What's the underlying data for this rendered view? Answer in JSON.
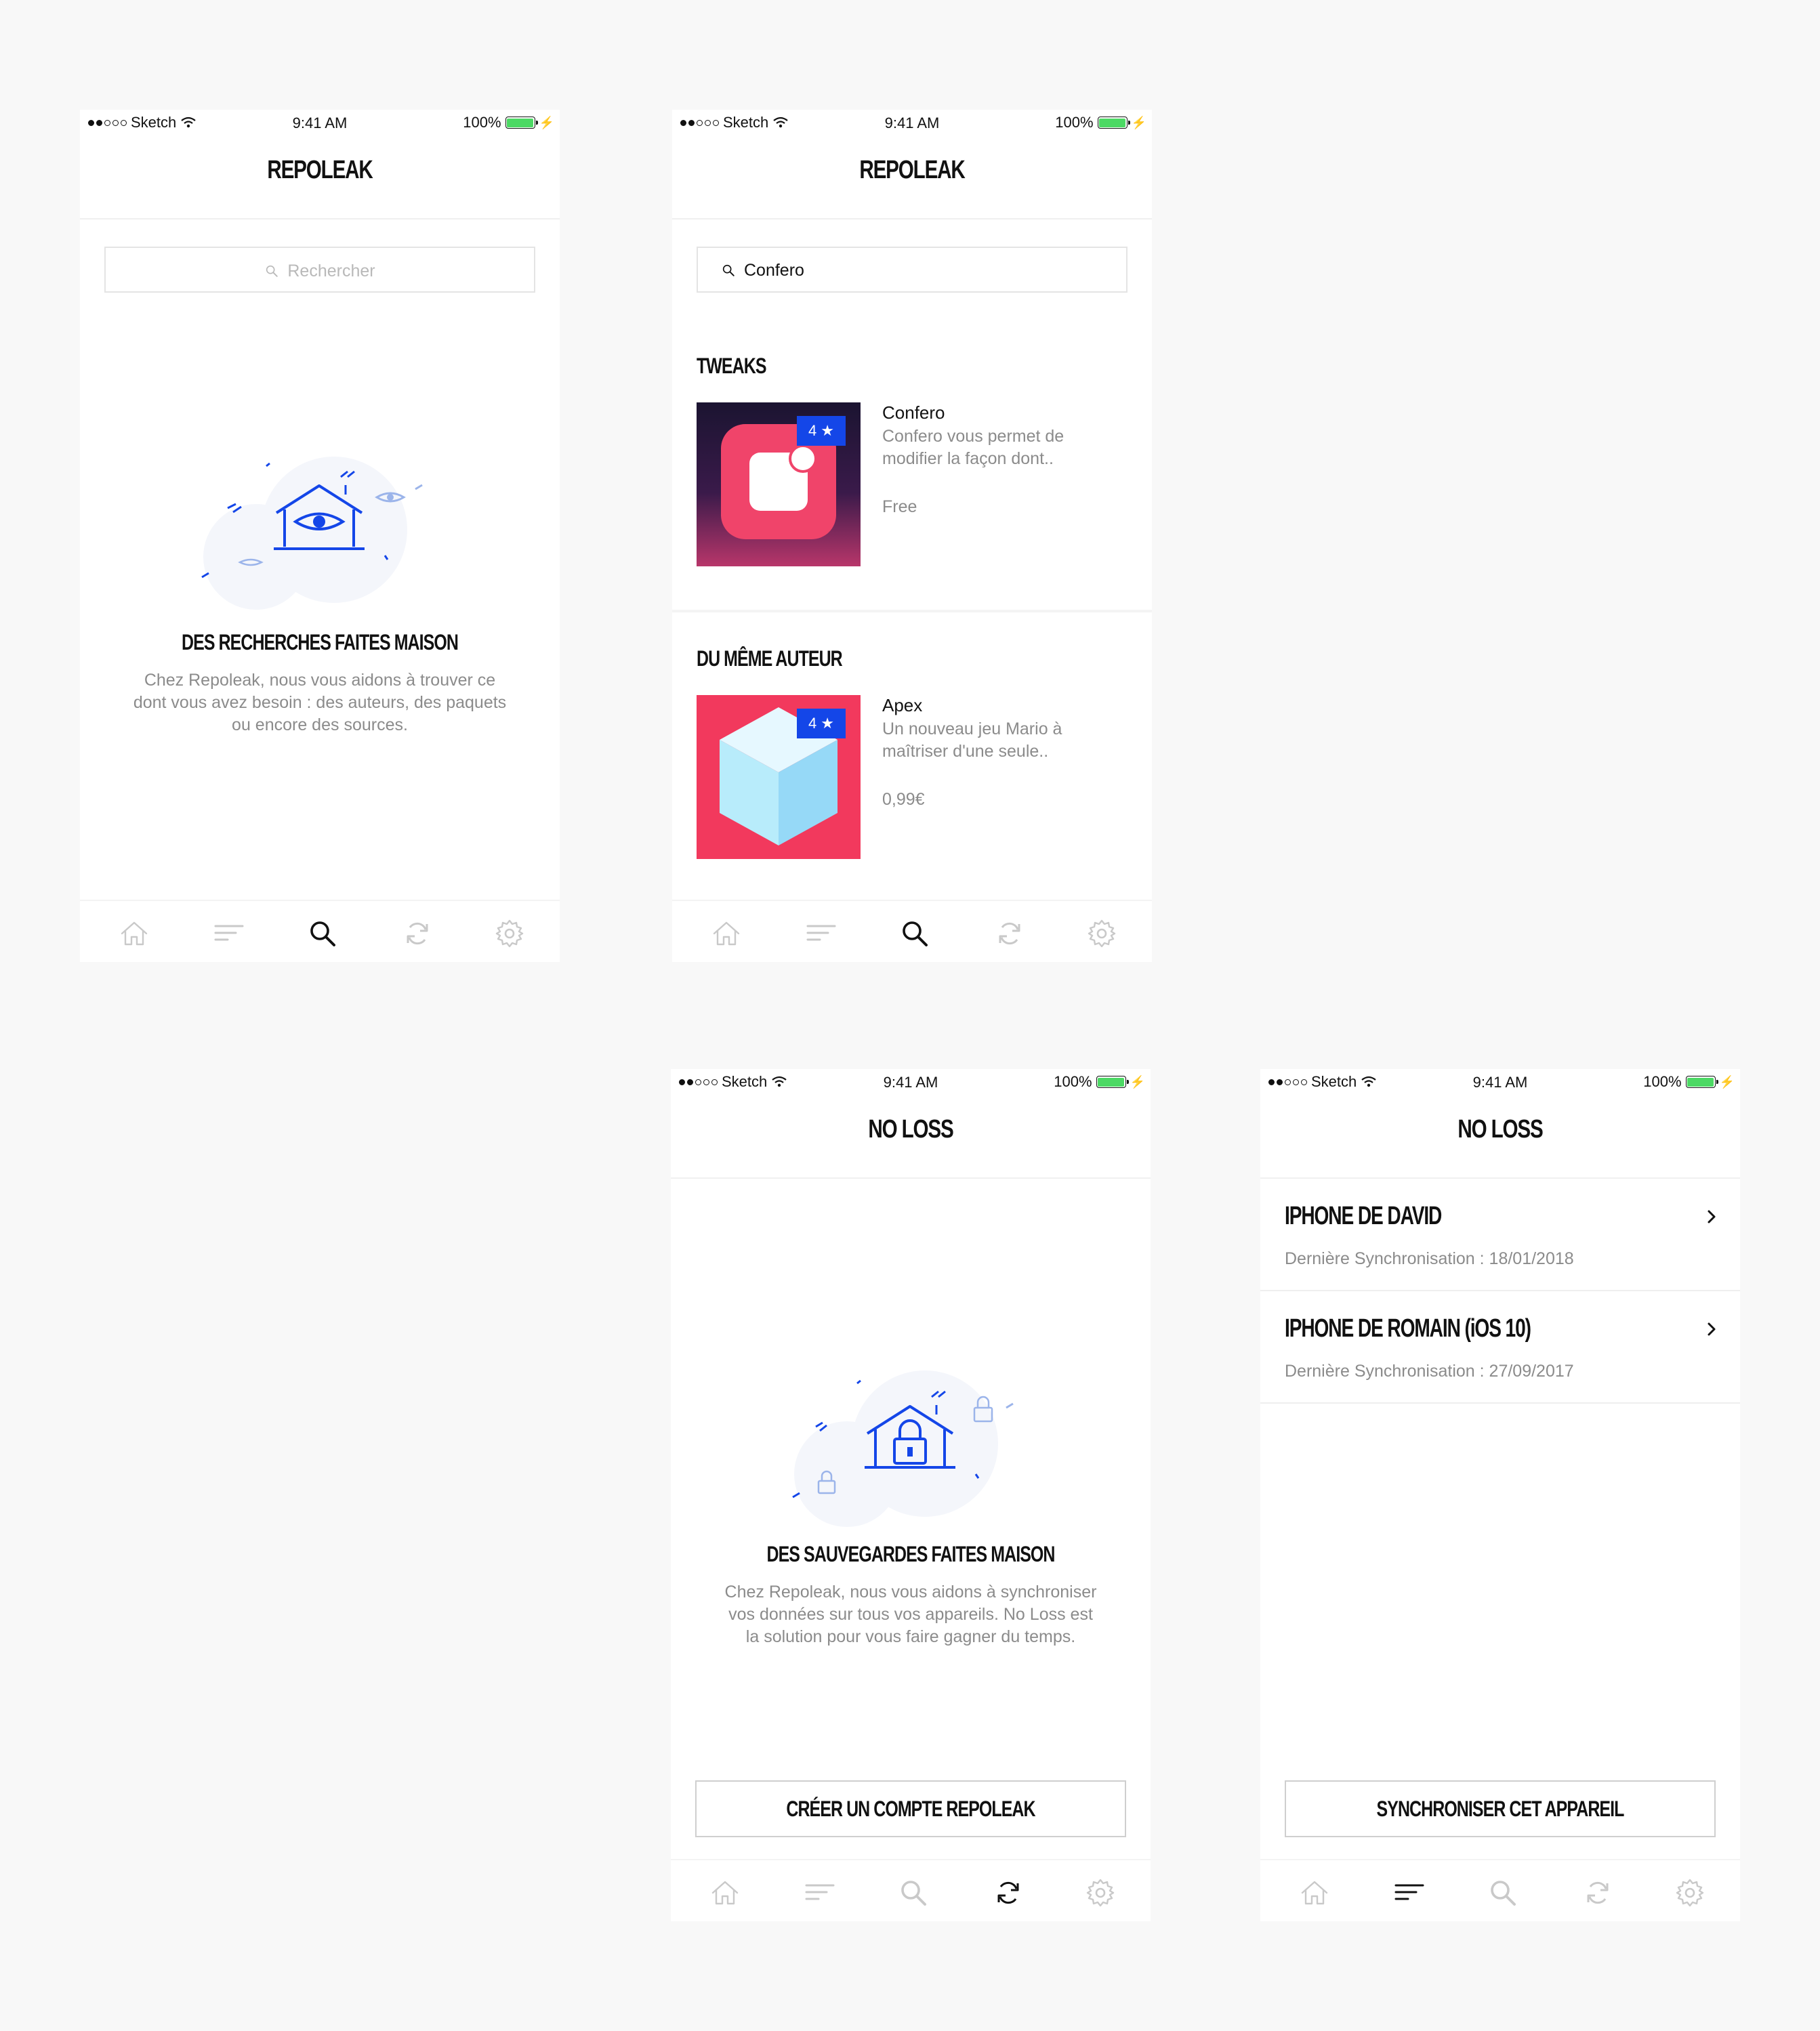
{
  "status_bar": {
    "carrier": "Sketch",
    "time": "9:41 AM",
    "battery": "100%"
  },
  "colors": {
    "accent": "#1446e8",
    "background": "#f8f8f8",
    "muted_text": "#8b8b8b",
    "battery_green": "#4cd964"
  },
  "screen1": {
    "title": "REPOLEAK",
    "search_placeholder": "Rechercher",
    "empty_title": "DES RECHERCHES FAITES MAISON",
    "empty_text": "Chez Repoleak, nous vous aidons à trouver ce dont vous avez besoin : des auteurs, des paquets ou encore des sources.",
    "active_tab": "search"
  },
  "screen2": {
    "title": "REPOLEAK",
    "search_value": "Confero",
    "section1_title": "TWEAKS",
    "app1": {
      "name": "Confero",
      "desc": "Confero vous permet de modifier la façon dont..",
      "price": "Free",
      "rating": "4 ★"
    },
    "section2_title": "DU MÊME AUTEUR",
    "app2": {
      "name": "Apex",
      "desc": "Un nouveau jeu Mario à maîtriser d'une seule..",
      "price": "0,99€",
      "rating": "4 ★"
    },
    "active_tab": "search"
  },
  "screen3": {
    "title": "NO LOSS",
    "empty_title": "DES SAUVEGARDES FAITES MAISON",
    "empty_text": "Chez Repoleak, nous vous aidons à synchroniser vos données sur tous vos appareils. No Loss est la solution pour vous faire gagner du temps.",
    "button": "CRÉER UN COMPTE REPOLEAK",
    "active_tab": "sync"
  },
  "screen4": {
    "title": "NO LOSS",
    "devices": [
      {
        "name": "IPHONE DE DAVID",
        "sync": "Dernière Synchronisation : 18/01/2018"
      },
      {
        "name": "IPHONE DE ROMAIN (iOS 10)",
        "sync": "Dernière Synchronisation : 27/09/2017"
      }
    ],
    "button": "SYNCHRONISER CET APPAREIL",
    "active_tab": "list"
  },
  "tabs": [
    "home-icon",
    "list-icon",
    "search-icon",
    "sync-icon",
    "gear-icon"
  ]
}
